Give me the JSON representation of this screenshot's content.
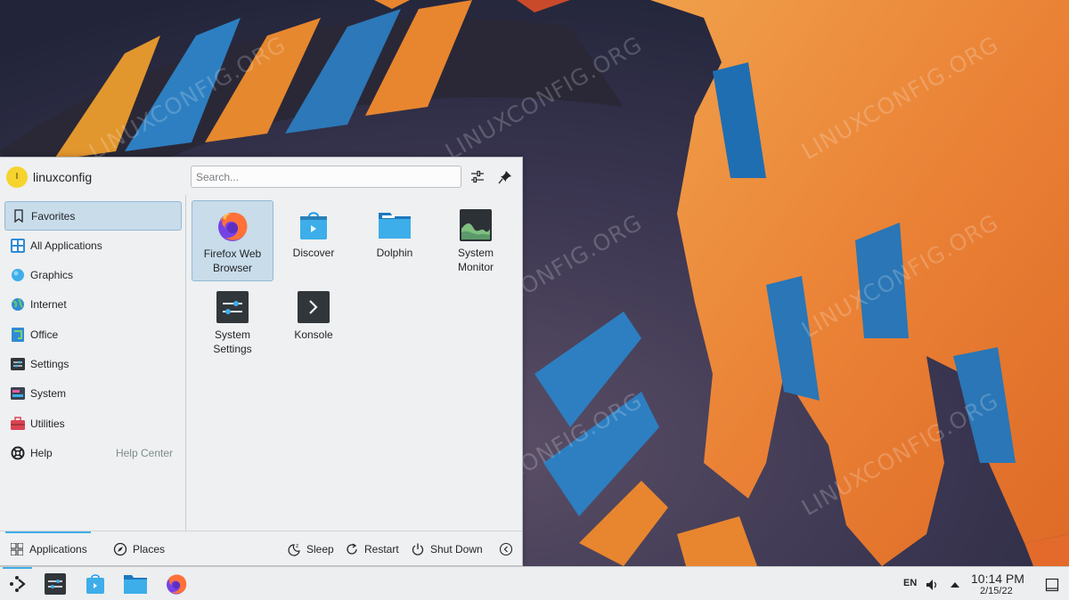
{
  "watermark": "LINUXCONFIG.ORG",
  "launcher": {
    "avatar_letter": "I",
    "username": "linuxconfig",
    "search_placeholder": "Search...",
    "sidebar": [
      {
        "label": "Favorites",
        "icon": "bookmark-icon"
      },
      {
        "label": "All Applications",
        "icon": "all-applications-icon"
      },
      {
        "label": "Graphics",
        "icon": "graphics-icon"
      },
      {
        "label": "Internet",
        "icon": "internet-icon"
      },
      {
        "label": "Office",
        "icon": "office-icon"
      },
      {
        "label": "Settings",
        "icon": "settings-icon"
      },
      {
        "label": "System",
        "icon": "system-icon"
      },
      {
        "label": "Utilities",
        "icon": "utilities-icon"
      },
      {
        "label": "Help",
        "icon": "help-icon",
        "extra": "Help Center"
      }
    ],
    "apps": [
      {
        "label": "Firefox Web\nBrowser",
        "icon": "firefox-icon"
      },
      {
        "label": "Discover",
        "icon": "discover-icon"
      },
      {
        "label": "Dolphin",
        "icon": "dolphin-icon"
      },
      {
        "label": "System\nMonitor",
        "icon": "system-monitor-icon"
      },
      {
        "label": "System\nSettings",
        "icon": "system-settings-icon"
      },
      {
        "label": "Konsole",
        "icon": "konsole-icon"
      }
    ],
    "footer": {
      "applications": "Applications",
      "places": "Places",
      "sleep": "Sleep",
      "restart": "Restart",
      "shut_down": "Shut Down"
    }
  },
  "panel": {
    "keyboard_layout": "EN",
    "time": "10:14 PM",
    "date": "2/15/22"
  },
  "colors": {
    "accent": "#3daee9",
    "selection": "#c8dcea",
    "panel_bg": "#eceeef",
    "launcher_bg": "#eef0f1"
  }
}
